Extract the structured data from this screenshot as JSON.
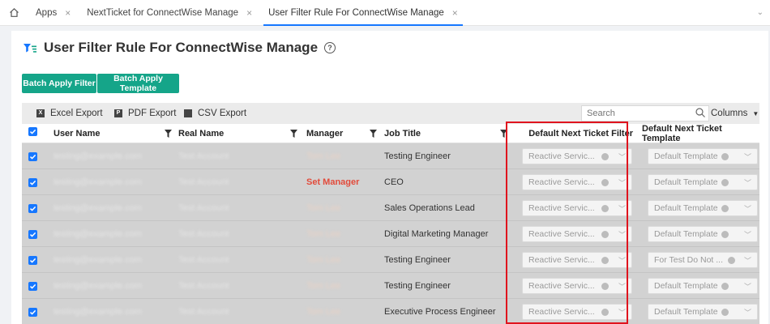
{
  "tabs": [
    {
      "label": "Apps",
      "active": false
    },
    {
      "label": "NextTicket for ConnectWise Manage",
      "active": false
    },
    {
      "label": "User Filter Rule For ConnectWise Manage",
      "active": true
    }
  ],
  "title": "User Filter Rule For ConnectWise Manage",
  "buttons": {
    "batch_apply_filter": "Batch Apply Filter",
    "batch_apply_template": "Batch Apply Template"
  },
  "toolbar": {
    "excel_export": "Excel Export",
    "pdf_export": "PDF Export",
    "csv_export": "CSV Export",
    "search_placeholder": "Search",
    "columns": "Columns"
  },
  "columns": {
    "user_name": "User Name",
    "real_name": "Real Name",
    "manager": "Manager",
    "job_title": "Job Title",
    "default_filter": "Default Next Ticket Filter",
    "default_template": "Default Next Ticket Template"
  },
  "rows": [
    {
      "user_name": "testing@example.com",
      "real_name": "Test Account",
      "manager": "Tom Lee",
      "job_title": "Testing Engineer",
      "filter": "Reactive Servic...",
      "template": "Default Template"
    },
    {
      "user_name": "testing@example.com",
      "real_name": "Test Account",
      "manager": "Set Manager",
      "job_title": "CEO",
      "filter": "Reactive Servic...",
      "template": "Default Template"
    },
    {
      "user_name": "testing@example.com",
      "real_name": "Test Account",
      "manager": "Tom Lee",
      "job_title": "Sales Operations Lead",
      "filter": "Reactive Servic...",
      "template": "Default Template"
    },
    {
      "user_name": "testing@example.com",
      "real_name": "Test Account",
      "manager": "Tom Lee",
      "job_title": "Digital Marketing Manager",
      "filter": "Reactive Servic...",
      "template": "Default Template"
    },
    {
      "user_name": "testing@example.com",
      "real_name": "Test Account",
      "manager": "Tom Lee",
      "job_title": "Testing Engineer",
      "filter": "Reactive Servic...",
      "template": "For Test Do Not ..."
    },
    {
      "user_name": "testing@example.com",
      "real_name": "Test Account",
      "manager": "Tom Lee",
      "job_title": "Testing Engineer",
      "filter": "Reactive Servic...",
      "template": "Default Template"
    },
    {
      "user_name": "testing@example.com",
      "real_name": "Test Account",
      "manager": "Tom Lee",
      "job_title": "Executive Process Engineer",
      "filter": "Reactive Servic...",
      "template": "Default Template"
    }
  ],
  "colors": {
    "accent": "#15a589",
    "primary": "#1677ff",
    "highlight": "#e0141e",
    "warning_text": "#e24b3b"
  }
}
